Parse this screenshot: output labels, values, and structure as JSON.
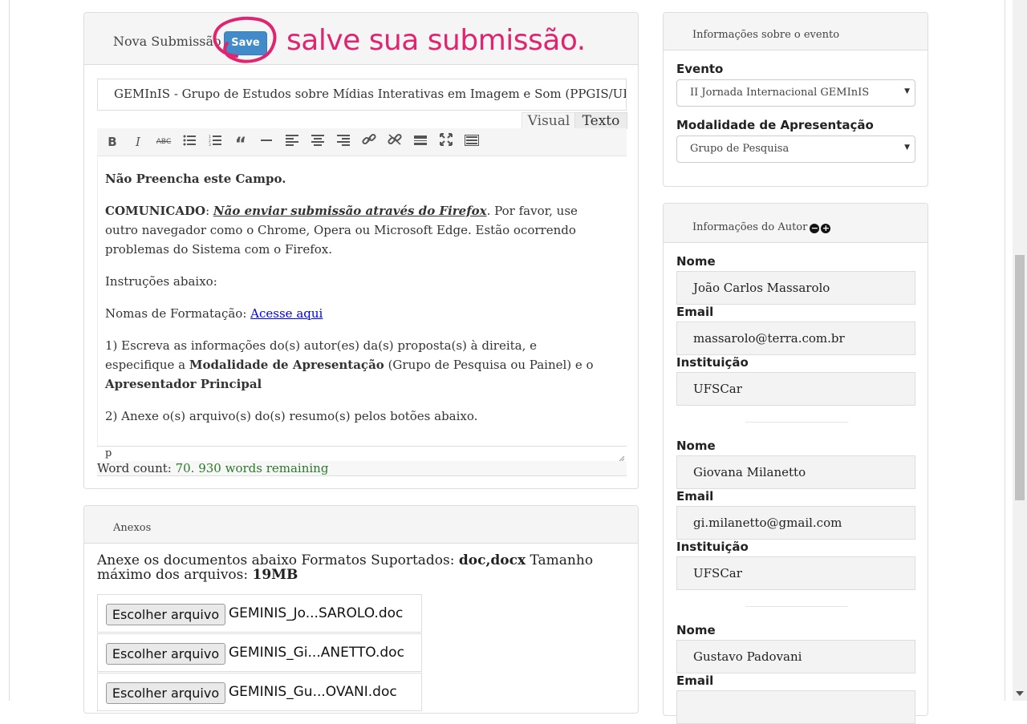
{
  "main": {
    "submission_title": "Nova Submissão",
    "save_label": "Save",
    "annotation": "salve sua submissão.",
    "title_value": "GEMInIS - Grupo de Estudos sobre Mídias Interativas em Imagem e Som (PPGIS/UFSCar)",
    "tabs": {
      "visual": "Visual",
      "texto": "Texto"
    },
    "toolbar": [
      "bold-icon",
      "italic-icon",
      "strikethrough-icon",
      "bullet-list-icon",
      "numbered-list-icon",
      "blockquote-icon",
      "horizontal-rule-icon",
      "align-left-icon",
      "align-center-icon",
      "align-right-icon",
      "link-icon",
      "unlink-icon",
      "read-more-icon",
      "fullscreen-icon",
      "toolbar-toggle-icon"
    ],
    "editor": {
      "line1": "Não Preencha este Campo.",
      "comunicado_label": "COMUNICADO",
      "comunicado_colon": ": ",
      "comunicado_warning": "Não enviar submissão através do Firefox",
      "comunicado_rest": ". Por favor, use outro navegador como o Chrome, Opera ou Microsoft Edge. Estão ocorrendo problemas do Sistema com o Firefox.",
      "instrucoes": "Instruções abaixo:",
      "normas_label": "Nomas de Formatação: ",
      "normas_link": "Acesse aqui",
      "step1_a": "1) Escreva as informações do(s) autor(es) da(s) proposta(s) à direita, e especifique a ",
      "step1_b": "Modalidade de Apresentação",
      "step1_c": " (Grupo de Pesquisa ou Painel) e o ",
      "step1_d": "Apresentador Principal",
      "step2": "2) Anexe o(s) arquivo(s) do(s) resumo(s) pelos botões abaixo."
    },
    "status_path": "p",
    "word_count_label": "Word count: ",
    "word_count_value": "70. 930 words remaining"
  },
  "anexos": {
    "title": "Anexos",
    "desc_a": "Anexe os documentos abaixo Formatos Suportados: ",
    "desc_formats": "doc,docx",
    "desc_b": " Tamanho máximo dos arquivos: ",
    "desc_size": "19MB",
    "button_label": "Escolher arquivo",
    "files": [
      "GEMINIS_Jo...SAROLO.doc",
      "GEMINIS_Gi...ANETTO.doc",
      "GEMINIS_Gu...OVANI.doc"
    ]
  },
  "event": {
    "title": "Informações sobre o evento",
    "evento_label": "Evento",
    "evento_value": "II Jornada Internacional GEMInIS",
    "modalidade_label": "Modalidade de Apresentação",
    "modalidade_value": "Grupo de Pesquisa"
  },
  "author": {
    "title": "Informações do Autor",
    "labels": {
      "nome": "Nome",
      "email": "Email",
      "instituicao": "Instituição"
    },
    "authors": [
      {
        "nome": "João Carlos Massarolo",
        "email": "massarolo@terra.com.br",
        "instituicao": "UFSCar"
      },
      {
        "nome": "Giovana Milanetto",
        "email": "gi.milanetto@gmail.com",
        "instituicao": "UFSCar"
      },
      {
        "nome": "Gustavo Padovani",
        "email": "",
        "instituicao": ""
      }
    ]
  },
  "colors": {
    "accent": "#428bca",
    "annotation": "#e0246f",
    "wordcount": "#2a7a2a"
  }
}
